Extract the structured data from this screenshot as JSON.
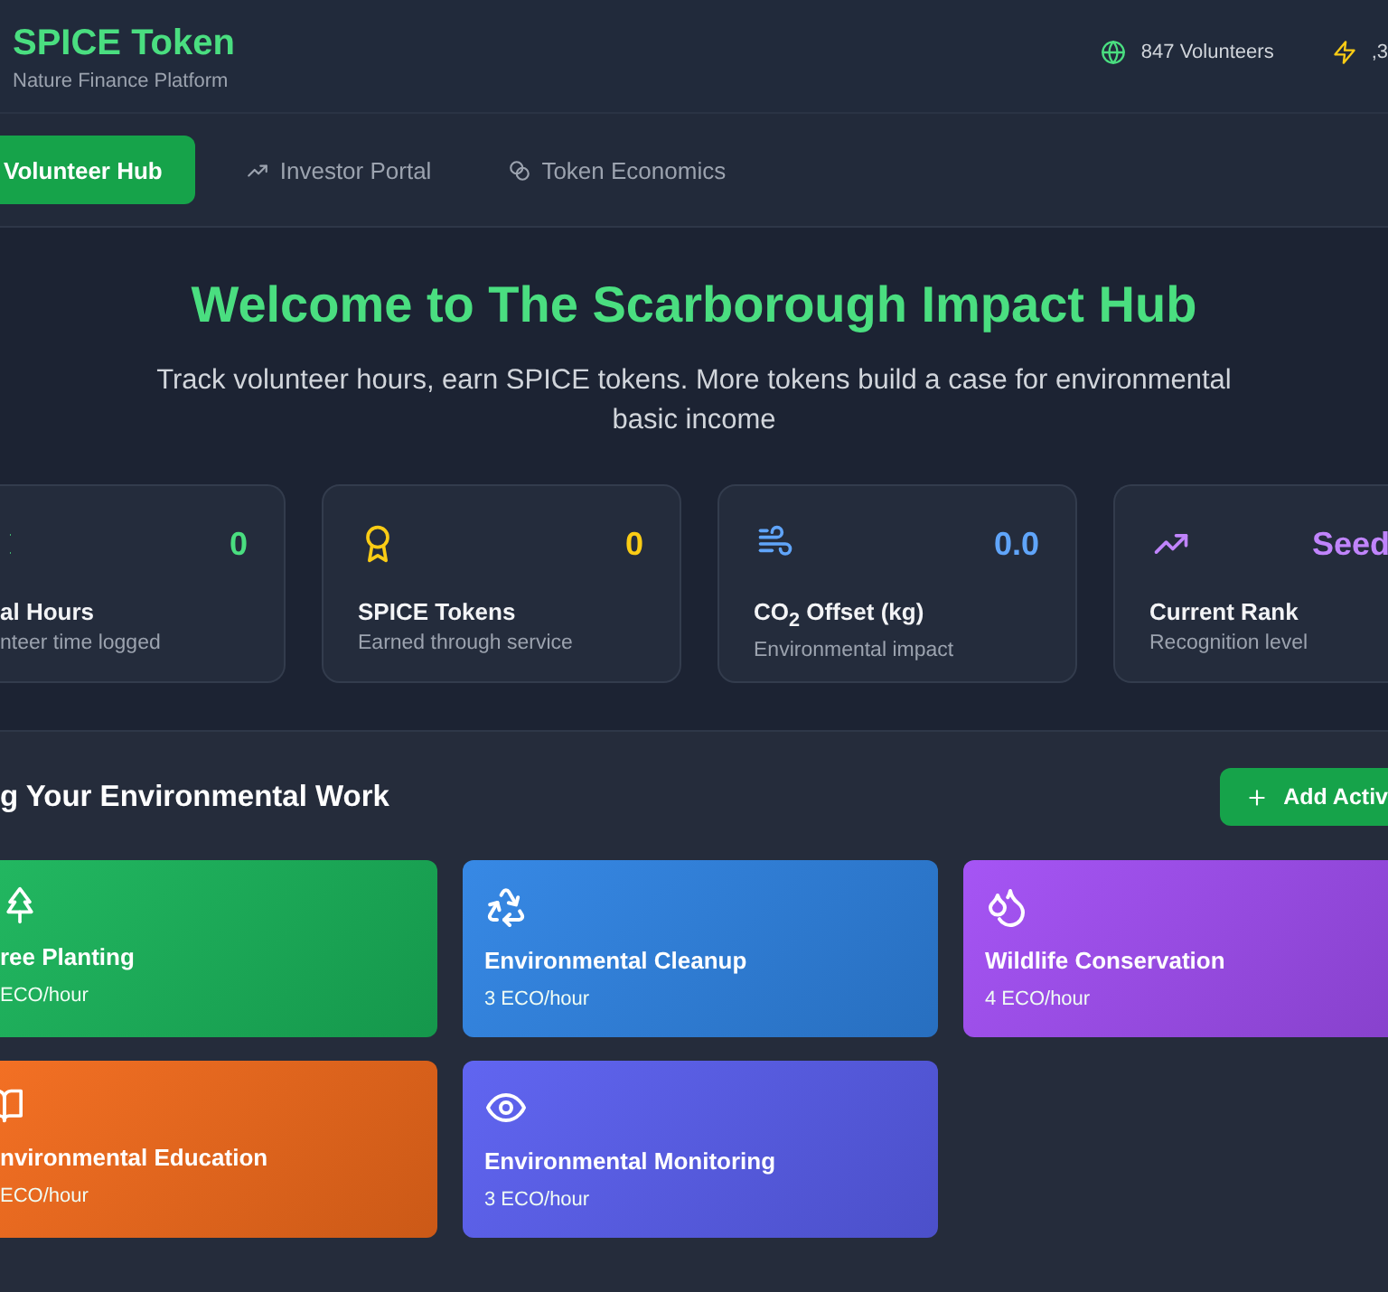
{
  "header": {
    "title": "SPICE Token",
    "subtitle": "Nature Finance Platform",
    "volunteers": "847 Volunteers",
    "stat_cut": ",3"
  },
  "tabs": [
    {
      "label": "Volunteer Hub",
      "selected": true
    },
    {
      "label": "Investor Portal",
      "selected": false
    },
    {
      "label": "Token Economics",
      "selected": false
    }
  ],
  "hero": {
    "title": "Welcome to The Scarborough Impact Hub",
    "subtitle": "Track volunteer hours, earn SPICE tokens. More tokens build a case for environmental basic income"
  },
  "stats": [
    {
      "value": "0",
      "label": "al Hours",
      "caption": "nteer time logged",
      "color": "#4ade80"
    },
    {
      "value": "0",
      "label": "SPICE Tokens",
      "caption": "Earned through service",
      "color": "#facc15"
    },
    {
      "value": "0.0",
      "label": "CO$_{2}$ Offset (kg)",
      "caption": "Environmental impact",
      "color": "#60a5fa"
    },
    {
      "value": "Seed",
      "label": "Current Rank",
      "caption": "Recognition level",
      "color": "#c084fc"
    }
  ],
  "activities": {
    "heading": "g Your Environmental Work",
    "add_button": "Add Activ",
    "items": [
      {
        "name": "ree Planting",
        "rate": "ECO/hour",
        "color": "#19b45a"
      },
      {
        "name": "Environmental Cleanup",
        "rate": "3 ECO/hour",
        "color": "#2f84e4"
      },
      {
        "name": "Wildlife Conservation",
        "rate": "4 ECO/hour",
        "color": "#a24ef4"
      },
      {
        "name": "nvironmental Education",
        "rate": "ECO/hour",
        "color": "#f26a1b"
      },
      {
        "name": "Environmental Monitoring",
        "rate": "3 ECO/hour",
        "color": "#5a5ff0"
      }
    ]
  }
}
